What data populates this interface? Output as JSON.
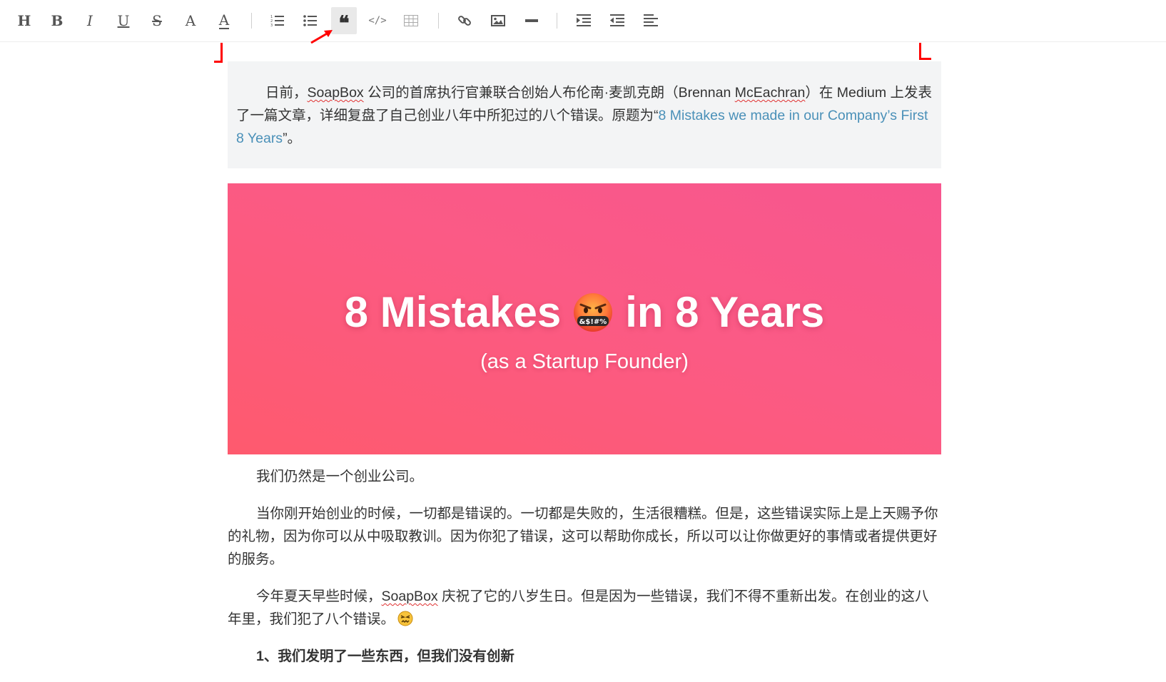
{
  "toolbar": {
    "buttons": [
      {
        "name": "heading-button",
        "icon": "heading-icon",
        "glyph": "H"
      },
      {
        "name": "bold-button",
        "icon": "bold-icon",
        "glyph": "B"
      },
      {
        "name": "italic-button",
        "icon": "italic-icon",
        "glyph": "I"
      },
      {
        "name": "underline-button",
        "icon": "underline-icon",
        "glyph": "U"
      },
      {
        "name": "strikethrough-button",
        "icon": "strikethrough-icon",
        "glyph": "S"
      },
      {
        "name": "font-size-button",
        "icon": "font-size-icon",
        "glyph": "A"
      },
      {
        "name": "font-color-button",
        "icon": "font-color-icon",
        "glyph": "A"
      },
      {
        "name": "ordered-list-button",
        "icon": "ordered-list-icon"
      },
      {
        "name": "unordered-list-button",
        "icon": "unordered-list-icon"
      },
      {
        "name": "blockquote-button",
        "icon": "quote-icon",
        "glyph": "❝",
        "active": true
      },
      {
        "name": "code-button",
        "icon": "code-icon",
        "glyph": "</>"
      },
      {
        "name": "table-button",
        "icon": "table-icon"
      },
      {
        "name": "link-button",
        "icon": "link-icon"
      },
      {
        "name": "image-button",
        "icon": "image-icon"
      },
      {
        "name": "horizontal-rule-button",
        "icon": "horizontal-rule-icon"
      },
      {
        "name": "indent-button",
        "icon": "indent-icon"
      },
      {
        "name": "outdent-button",
        "icon": "outdent-icon"
      },
      {
        "name": "align-button",
        "icon": "align-left-icon"
      }
    ]
  },
  "colors": {
    "accent_red": "#ff0000",
    "quote_bg": "#f3f4f5",
    "link": "#4a90b8",
    "banner_from": "#f7568f",
    "banner_to": "#fe5a6e"
  },
  "quote": {
    "seg1": "日前，",
    "soapbox": "SoapBox",
    "seg2": " 公司的首席执行官兼联合创始人布伦南·麦凯克朗（Brennan ",
    "mceachran": "McEachran",
    "seg3": "）在 Medium 上发表了一篇文章，详细复盘了自己创业八年中所犯过的八个错误。原题为“",
    "link_text": "8 Mistakes we made in our Company’s First 8 Years",
    "seg4": "”。"
  },
  "banner": {
    "title_left": "8 Mistakes",
    "title_right": "in 8 Years",
    "emoji_symbols": "&$!#%",
    "subtitle": "(as a Startup Founder)"
  },
  "article": {
    "p1": "我们仍然是一个创业公司。",
    "p2": "当你刚开始创业的时候，一切都是错误的。一切都是失败的，生活很糟糕。但是，这些错误实际上是上天赐予你的礼物，因为你可以从中吸取教训。因为你犯了错误，这可以帮助你成长，所以可以让你做更好的事情或者提供更好的服务。",
    "p3_a": "今年夏天早些时候，",
    "p3_soapbox": "SoapBox",
    "p3_b": " 庆祝了它的八岁生日。但是因为一些错误，我们不得不重新出发。在创业的这八年里，我们犯了八个错误。",
    "heading1": "1、我们发明了一些东西，但我们没有创新"
  }
}
